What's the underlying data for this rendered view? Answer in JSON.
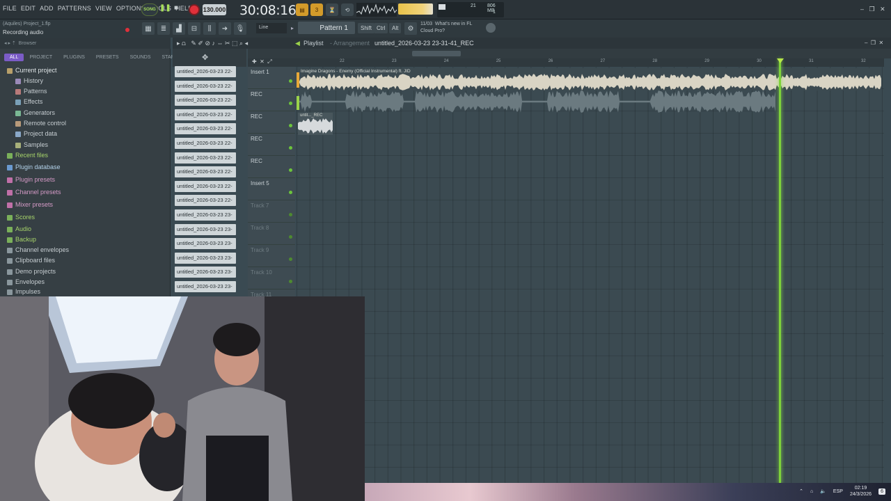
{
  "menu": [
    "FILE",
    "EDIT",
    "ADD",
    "PATTERNS",
    "VIEW",
    "OPTIONS",
    "TOOLS",
    "HELP"
  ],
  "transport": {
    "song_label": "SONG",
    "tempo": "130.000",
    "time": "30:08:16"
  },
  "monitor": {
    "cpu_num": "21",
    "memory": "806 MB",
    "voices": "1"
  },
  "project": {
    "file": "(Aquiles) Project_1.flp",
    "hint": "Recording audio"
  },
  "toolbar2": {
    "snap": "Line",
    "pattern": "Pattern 1",
    "keys": [
      "Shift",
      "Ctrl",
      "Alt"
    ],
    "news_date": "11/03",
    "news_text": "What's new in FL Cloud Pro?"
  },
  "browser": {
    "title": "Browser",
    "tabs": [
      "ALL",
      "PROJECT",
      "PLUGINS",
      "PRESETS",
      "SOUNDS",
      "STARRED"
    ],
    "items": [
      {
        "label": "Current project",
        "color": "#e0e6e8",
        "icon": "#b8a06a"
      },
      {
        "label": "History",
        "color": "#c6cdd1",
        "icon": "#9a8ab8"
      },
      {
        "label": "Patterns",
        "color": "#c6cdd1",
        "icon": "#b87a7a"
      },
      {
        "label": "Effects",
        "color": "#c6cdd1",
        "icon": "#7aa0b8"
      },
      {
        "label": "Generators",
        "color": "#c6cdd1",
        "icon": "#7ab894"
      },
      {
        "label": "Remote control",
        "color": "#c6cdd1",
        "icon": "#b89a7a"
      },
      {
        "label": "Project data",
        "color": "#c6cdd1",
        "icon": "#8aa8c8"
      },
      {
        "label": "Samples",
        "color": "#c6cdd1",
        "icon": "#a8b07a"
      },
      {
        "label": "Recent files",
        "color": "#a7d46a",
        "icon": "#7ab05a"
      },
      {
        "label": "Plugin database",
        "color": "#b3d2ea",
        "icon": "#6a9ad0"
      },
      {
        "label": "Plugin presets",
        "color": "#d49ac6",
        "icon": "#c070a8"
      },
      {
        "label": "Channel presets",
        "color": "#d49ac6",
        "icon": "#c070a8"
      },
      {
        "label": "Mixer presets",
        "color": "#d49ac6",
        "icon": "#c070a8"
      },
      {
        "label": "Scores",
        "color": "#a7d46a",
        "icon": "#7ab05a"
      },
      {
        "label": "Audio",
        "color": "#a7d46a",
        "icon": "#7ab05a"
      },
      {
        "label": "Backup",
        "color": "#a7d46a",
        "icon": "#7ab05a"
      },
      {
        "label": "Channel envelopes",
        "color": "#c6cdd1",
        "icon": "#8a979d"
      },
      {
        "label": "Clipboard files",
        "color": "#c6cdd1",
        "icon": "#8a979d"
      },
      {
        "label": "Demo projects",
        "color": "#c6cdd1",
        "icon": "#8a979d"
      },
      {
        "label": "Envelopes",
        "color": "#c6cdd1",
        "icon": "#8a979d"
      },
      {
        "label": "Impulses",
        "color": "#c6cdd1",
        "icon": "#8a979d"
      }
    ]
  },
  "clips": [
    "untitled_2026-03-23 22-",
    "untitled_2026-03-23 22-",
    "untitled_2026-03-23 22-",
    "untitled_2026-03-23 22-",
    "untitled_2026-03-23 22-",
    "untitled_2026-03-23 22-",
    "untitled_2026-03-23 22-",
    "untitled_2026-03-23 22-",
    "untitled_2026-03-23 22-",
    "untitled_2026-03-23 22-",
    "untitled_2026-03-23 23-",
    "untitled_2026-03-23 23-",
    "untitled_2026-03-23 23-",
    "untitled_2026-03-23 23-",
    "untitled_2026-03-23 23-",
    "untitled_2026-03-23 23-"
  ],
  "playlist": {
    "title": "Playlist",
    "subtitle": "- Arrangement",
    "current_clip": "untitled_2026-03-23 23-31-41_REC",
    "ruler": [
      "22",
      "23",
      "24",
      "25",
      "26",
      "27",
      "28",
      "29",
      "30",
      "31",
      "32"
    ],
    "tracks": [
      {
        "label": "Insert 1",
        "dim": false
      },
      {
        "label": "REC",
        "dim": false
      },
      {
        "label": "REC",
        "dim": false
      },
      {
        "label": "REC",
        "dim": false
      },
      {
        "label": "REC",
        "dim": false
      },
      {
        "label": "Insert 5",
        "dim": false
      },
      {
        "label": "Track 7",
        "dim": true
      },
      {
        "label": "Track 8",
        "dim": true
      },
      {
        "label": "Track 9",
        "dim": true
      },
      {
        "label": "Track 10",
        "dim": true
      },
      {
        "label": "Track 11",
        "dim": true
      }
    ],
    "audio_clip_1": "Imagine Dragons - Enemy (Official Instrumental) ft. JID",
    "audio_clip_3": "untit..._REC"
  },
  "tray": {
    "lang": "ESP",
    "time": "02:19",
    "date": "24/3/2026",
    "notif": "6"
  }
}
